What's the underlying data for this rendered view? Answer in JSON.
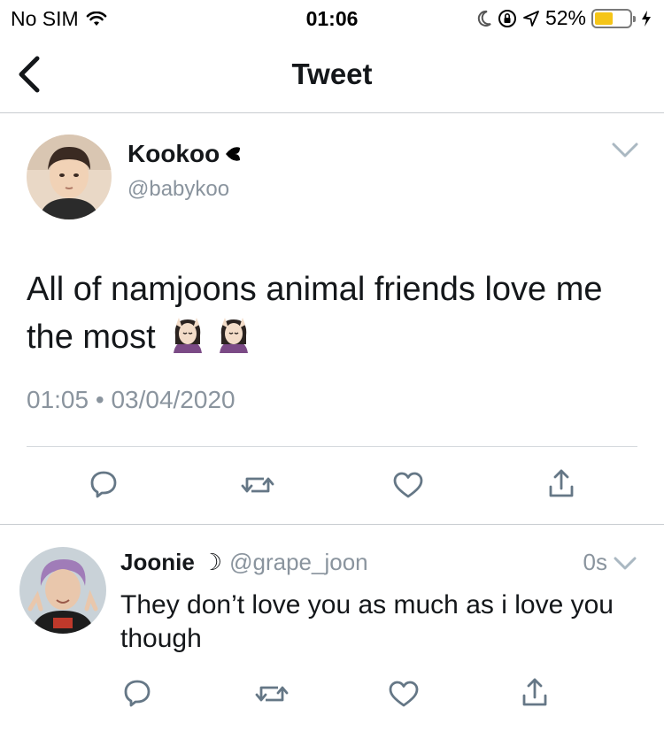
{
  "status_bar": {
    "carrier": "No SIM",
    "time": "01:06",
    "battery_percent": "52%",
    "battery_level": 0.52,
    "battery_color": "#f5c518",
    "icons": [
      "wifi-icon",
      "moon-icon",
      "orientation-lock-icon",
      "location-arrow-icon",
      "battery-icon",
      "charging-bolt-icon"
    ]
  },
  "nav": {
    "title": "Tweet",
    "back_icon": "chevron-left-icon"
  },
  "tweet": {
    "author_name": "Kookoo",
    "author_suffix_icon": "black-heart-icon",
    "author_handle": "@babykoo",
    "text": "All of namjoons animal friends love me the most",
    "emojis": [
      "bunny-ears-face-emoji",
      "bunny-ears-face-emoji"
    ],
    "time": "01:05",
    "separator": "•",
    "date": "03/04/2020",
    "actions": [
      "reply-icon",
      "retweet-icon",
      "like-icon",
      "share-icon"
    ]
  },
  "reply": {
    "author_name": "Joonie",
    "author_suffix": "☽",
    "author_handle": "@grape_joon",
    "time": "0s",
    "text": "They don’t love you as much as i love you though",
    "actions": [
      "reply-icon",
      "retweet-icon",
      "like-icon",
      "share-icon"
    ]
  },
  "colors": {
    "text_primary": "#14171a",
    "text_secondary": "#8a949e",
    "icon_gray": "#657786",
    "divider": "#c8ccd0"
  }
}
